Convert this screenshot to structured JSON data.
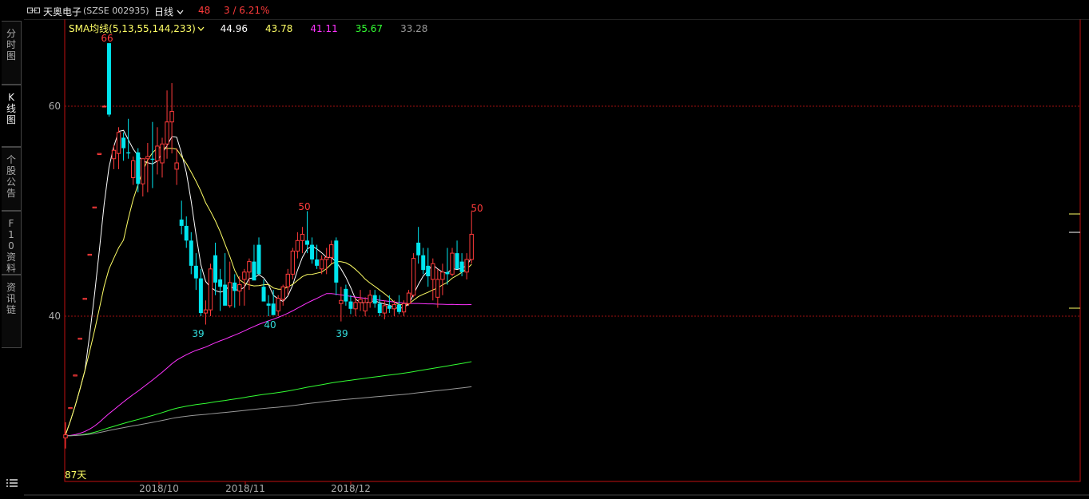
{
  "header": {
    "stock_name": "天奥电子",
    "stock_code": "(SZSE 002935)",
    "period": "日线",
    "period_chevron": "chevron-down-icon",
    "price": "48",
    "change": "3 / 6.21%",
    "price_color": "#ff3b3b"
  },
  "sidebar": {
    "tabs": [
      {
        "label": "分时图"
      },
      {
        "label": "K线图"
      },
      {
        "label": "个股公告"
      },
      {
        "label": "F10资料"
      },
      {
        "label": "资讯链"
      }
    ],
    "menu_icon": "list-icon"
  },
  "indicator": {
    "label": "SMA均线(5,13,55,144,233)",
    "values": [
      {
        "text": "44.96",
        "color": "#ffffff"
      },
      {
        "text": "43.78",
        "color": "#ffff66"
      },
      {
        "text": "41.11",
        "color": "#ff33ff"
      },
      {
        "text": "35.67",
        "color": "#33ff33"
      },
      {
        "text": "33.28",
        "color": "#999999"
      }
    ]
  },
  "chart_data": {
    "type": "candlestick",
    "y_ticks": [
      "60",
      "40"
    ],
    "x_ticks": [
      "2018/10",
      "2018/11",
      "2018/12"
    ],
    "ylim": [
      28,
      65
    ],
    "annotations": [
      {
        "text": "66",
        "color": "#ff3b3b"
      },
      {
        "text": "39",
        "color": "#33dddd"
      },
      {
        "text": "40",
        "color": "#33dddd"
      },
      {
        "text": "50",
        "color": "#ff3b3b"
      },
      {
        "text": "39",
        "color": "#33dddd"
      },
      {
        "text": "50",
        "color": "#ff3b3b"
      }
    ],
    "bottom_label": "87天",
    "up_color": "#ff3b3b",
    "down_color": "#00e5ee",
    "candles": [
      [
        28.4,
        29.9,
        27.4,
        28.7
      ],
      [
        31.2,
        31.3,
        31.2,
        31.3
      ],
      [
        34.3,
        34.4,
        34.3,
        34.4
      ],
      [
        37.8,
        37.9,
        37.8,
        37.9
      ],
      [
        41.6,
        41.7,
        41.6,
        41.7
      ],
      [
        45.8,
        45.9,
        45.8,
        45.9
      ],
      [
        50.3,
        50.4,
        50.3,
        50.4
      ],
      [
        55.4,
        55.5,
        55.4,
        55.5
      ],
      [
        60.0,
        60.1,
        59.9,
        60.0
      ],
      [
        66.0,
        66.0,
        59.0,
        59.2
      ],
      [
        55.0,
        56.3,
        54.0,
        55.8
      ],
      [
        55.5,
        58.0,
        54.0,
        57.5
      ],
      [
        57.0,
        57.5,
        54.8,
        56.0
      ],
      [
        55.6,
        58.8,
        55.0,
        55.5
      ],
      [
        53.2,
        55.2,
        52.5,
        54.8
      ],
      [
        55.6,
        56.0,
        51.8,
        52.6
      ],
      [
        52.6,
        55.0,
        51.4,
        55.0
      ],
      [
        55.0,
        56.5,
        51.8,
        55.2
      ],
      [
        55.0,
        58.5,
        52.2,
        54.9
      ],
      [
        54.8,
        58.0,
        53.5,
        56.2
      ],
      [
        54.6,
        57.0,
        53.2,
        56.4
      ],
      [
        56.4,
        61.5,
        55.0,
        58.5
      ],
      [
        58.5,
        62.2,
        55.5,
        59.5
      ],
      [
        54.0,
        56.0,
        52.5,
        54.6
      ],
      [
        49.2,
        51.0,
        47.8,
        48.6
      ],
      [
        48.6,
        49.5,
        46.5,
        47.2
      ],
      [
        47.2,
        48.0,
        44.0,
        44.8
      ],
      [
        44.8,
        46.0,
        42.5,
        43.6
      ],
      [
        43.6,
        44.5,
        40.0,
        40.3
      ],
      [
        40.3,
        41.5,
        39.2,
        40.6
      ],
      [
        40.6,
        45.0,
        40.0,
        44.5
      ],
      [
        45.8,
        47.0,
        42.0,
        43.2
      ],
      [
        43.5,
        44.5,
        40.5,
        42.8
      ],
      [
        43.0,
        46.0,
        41.5,
        41.0
      ],
      [
        41.0,
        45.2,
        40.8,
        43.2
      ],
      [
        43.2,
        44.0,
        40.8,
        42.4
      ],
      [
        42.4,
        43.8,
        41.0,
        43.0
      ],
      [
        43.5,
        44.5,
        41.0,
        44.2
      ],
      [
        44.2,
        45.5,
        42.5,
        45.2
      ],
      [
        45.2,
        46.8,
        43.5,
        43.4
      ],
      [
        46.8,
        47.5,
        44.5,
        44.0
      ],
      [
        42.8,
        43.5,
        41.5,
        41.4
      ],
      [
        41.2,
        42.0,
        40.0,
        41.0
      ],
      [
        41.2,
        42.5,
        40.2,
        40.1
      ],
      [
        40.5,
        42.0,
        40.0,
        41.7
      ],
      [
        41.6,
        43.0,
        41.0,
        42.8
      ],
      [
        42.8,
        44.5,
        42.0,
        44.0
      ],
      [
        44.0,
        46.5,
        43.5,
        46.2
      ],
      [
        46.2,
        48.0,
        45.5,
        47.2
      ],
      [
        47.2,
        48.5,
        46.0,
        47.8
      ],
      [
        47.2,
        50.0,
        46.0,
        46.8
      ],
      [
        46.8,
        47.5,
        45.0,
        45.4
      ],
      [
        45.4,
        46.8,
        44.5,
        44.8
      ],
      [
        44.5,
        45.8,
        44.0,
        45.4
      ],
      [
        45.4,
        46.5,
        44.0,
        45.6
      ],
      [
        45.6,
        47.2,
        45.0,
        46.8
      ],
      [
        47.2,
        47.5,
        42.0,
        43.2
      ],
      [
        41.2,
        42.8,
        39.5,
        41.5
      ],
      [
        42.6,
        43.0,
        41.0,
        41.4
      ],
      [
        41.4,
        42.0,
        40.2,
        40.7
      ],
      [
        40.7,
        41.8,
        40.0,
        41.3
      ],
      [
        41.3,
        42.5,
        40.5,
        41.6
      ],
      [
        40.5,
        41.8,
        40.0,
        41.3
      ],
      [
        41.3,
        42.5,
        40.8,
        42.0
      ],
      [
        42.0,
        42.5,
        40.8,
        41.2
      ],
      [
        41.2,
        42.0,
        40.0,
        40.3
      ],
      [
        40.3,
        41.5,
        39.7,
        41.0
      ],
      [
        41.0,
        42.0,
        40.3,
        40.7
      ],
      [
        40.7,
        41.5,
        40.0,
        41.1
      ],
      [
        41.1,
        42.0,
        40.2,
        40.4
      ],
      [
        40.4,
        41.5,
        40.0,
        41.2
      ],
      [
        41.2,
        42.5,
        41.0,
        42.2
      ],
      [
        42.0,
        46.0,
        41.8,
        45.5
      ],
      [
        47.0,
        48.5,
        45.0,
        45.8
      ],
      [
        45.8,
        46.5,
        44.0,
        44.4
      ],
      [
        44.8,
        46.5,
        42.8,
        43.8
      ],
      [
        43.5,
        45.5,
        41.5,
        45.0
      ],
      [
        41.8,
        44.5,
        40.8,
        43.5
      ],
      [
        43.5,
        45.0,
        42.0,
        44.2
      ],
      [
        44.2,
        46.5,
        43.0,
        44.0
      ],
      [
        44.0,
        46.5,
        43.8,
        46.0
      ],
      [
        46.0,
        47.2,
        44.5,
        44.5
      ],
      [
        45.2,
        46.0,
        43.8,
        44.2
      ],
      [
        44.2,
        46.0,
        43.5,
        45.4
      ],
      [
        45.4,
        50.0,
        45.0,
        47.8
      ]
    ]
  }
}
